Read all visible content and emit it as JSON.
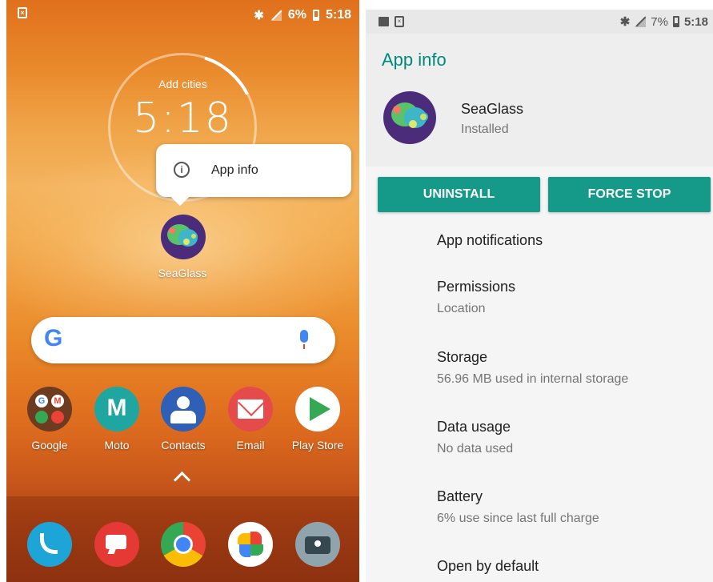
{
  "left": {
    "status_bar": {
      "battery": "6%",
      "time": "5:18"
    },
    "clock": {
      "add_cities": "Add cities",
      "time": "5:18"
    },
    "popup": {
      "label": "App info"
    },
    "app": {
      "label": "SeaGlass"
    },
    "search": {
      "logo": "G"
    },
    "apps": [
      {
        "label": "Google"
      },
      {
        "label": "Moto"
      },
      {
        "label": "Contacts"
      },
      {
        "label": "Email"
      },
      {
        "label": "Play Store"
      }
    ],
    "hotseat": [
      "phone-icon",
      "messages-icon",
      "chrome-icon",
      "photos-icon",
      "camera-icon"
    ]
  },
  "right": {
    "status_bar": {
      "battery": "7%",
      "time": "5:18"
    },
    "title": "App info",
    "app_name": "SeaGlass",
    "app_status": "Installed",
    "buttons": {
      "uninstall": "UNINSTALL",
      "force_stop": "FORCE STOP"
    },
    "items": [
      {
        "title": "App notifications",
        "subtitle": ""
      },
      {
        "title": "Permissions",
        "subtitle": "Location"
      },
      {
        "title": "Storage",
        "subtitle": "56.96 MB used in internal storage"
      },
      {
        "title": "Data usage",
        "subtitle": "No data used"
      },
      {
        "title": "Battery",
        "subtitle": "6% use since last full charge"
      },
      {
        "title": "Open by default",
        "subtitle": ""
      }
    ]
  },
  "colors": {
    "accent": "#00897b",
    "button": "#159a8a"
  }
}
